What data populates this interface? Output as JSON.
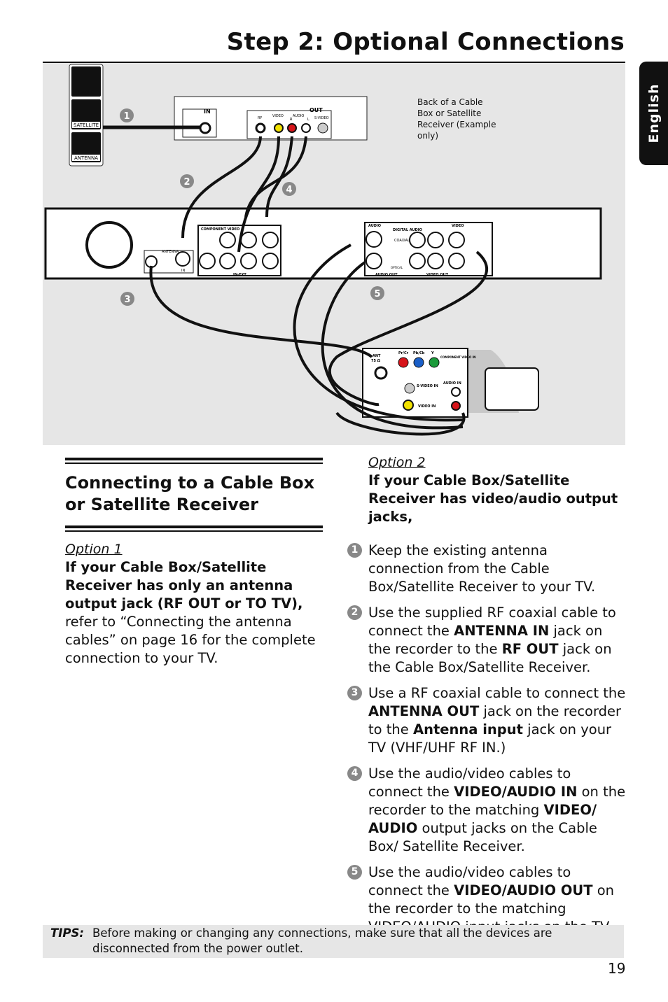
{
  "header": {
    "title": "Step 2: Optional Connections"
  },
  "side_tab": {
    "label": "English"
  },
  "diagram": {
    "source_icons": [
      "CABLE",
      "SATELLITE",
      "ANTENNA"
    ],
    "caption": [
      "Back of a Cable",
      "Box or Satellite",
      "Receiver (Example",
      "only)"
    ],
    "box_labels": {
      "in": "IN",
      "out": "OUT",
      "rf": "RF",
      "video": "VIDEO",
      "audio": "AUDIO",
      "r": "R",
      "l": "L",
      "svideo": "S-VIDEO"
    },
    "recorder_labels": {
      "component_video": "COMPONENT VIDEO",
      "antenna": "ANTENNA",
      "in": "IN",
      "in_ext": "IN-EXT",
      "audio": "AUDIO",
      "digital_audio": "DIGITAL AUDIO",
      "coaxial": "COAXIAL",
      "optical": "OPTICAL",
      "video": "VIDEO",
      "audio_out": "AUDIO OUT",
      "video_out": "VIDEO OUT"
    },
    "tv_labels": {
      "ant": "ANT",
      "ohm": "75 Ω",
      "prcr": "Pr/Cr",
      "pbcb": "Pb/Cb",
      "y": "Y",
      "component_video_in": "COMPONENT VIDEO IN",
      "svideo_in": "S-VIDEO IN",
      "audio_in": "AUDIO IN",
      "video_in": "VIDEO IN"
    },
    "markers": [
      "1",
      "2",
      "3",
      "4",
      "5"
    ]
  },
  "left": {
    "heading": "Connecting to a Cable Box or Satellite Receiver",
    "option_label": "Option 1",
    "option_heading": "If your Cable Box/Satellite Receiver has only an antenna output jack (RF OUT or TO TV),",
    "option_body": "refer to “Connecting the antenna cables” on page 16 for the complete connection to your TV."
  },
  "right": {
    "option_label": "Option 2",
    "option_heading": "If your Cable Box/Satellite Receiver has video/audio output jacks,",
    "steps": [
      {
        "num": "1",
        "parts": [
          [
            "Keep the existing antenna connection from the Cable Box/Satellite Receiver to your TV.",
            false
          ]
        ]
      },
      {
        "num": "2",
        "parts": [
          [
            "Use the supplied RF coaxial cable to connect the ",
            false
          ],
          [
            "ANTENNA IN",
            true
          ],
          [
            " jack on the recorder to the ",
            false
          ],
          [
            "RF OUT",
            true
          ],
          [
            " jack on the Cable Box/Satellite Receiver.",
            false
          ]
        ]
      },
      {
        "num": "3",
        "parts": [
          [
            "Use a RF coaxial cable to connect the ",
            false
          ],
          [
            "ANTENNA OUT",
            true
          ],
          [
            "  jack on the recorder to the ",
            false
          ],
          [
            "Antenna input",
            true
          ],
          [
            " jack on your TV (VHF/UHF RF IN.)",
            false
          ]
        ]
      },
      {
        "num": "4",
        "parts": [
          [
            "Use the audio/video cables to connect the ",
            false
          ],
          [
            "VIDEO/AUDIO IN",
            true
          ],
          [
            " on the recorder to the matching ",
            false
          ],
          [
            "VIDEO/ AUDIO",
            true
          ],
          [
            " output jacks on the Cable Box/ Satellite Receiver.",
            false
          ]
        ]
      },
      {
        "num": "5",
        "parts": [
          [
            "Use the audio/video cables to connect the ",
            false
          ],
          [
            "VIDEO/AUDIO OUT",
            true
          ],
          [
            " on the recorder to the matching VIDEO/AUDIO input jacks on the TV.",
            false
          ]
        ]
      }
    ]
  },
  "tips": {
    "label": "TIPS:",
    "text": "Before making or changing any connections, make sure that all the devices are disconnected from the power outlet."
  },
  "footer": {
    "page_number": "19"
  },
  "colors": {
    "diagram_bg": "#e6e6e6",
    "marker": "#888888",
    "tab": "#111111",
    "video_yellow": "#f2e200",
    "audio_red": "#d7141a",
    "green": "#1a9a3a",
    "blue": "#1a5fc8"
  }
}
